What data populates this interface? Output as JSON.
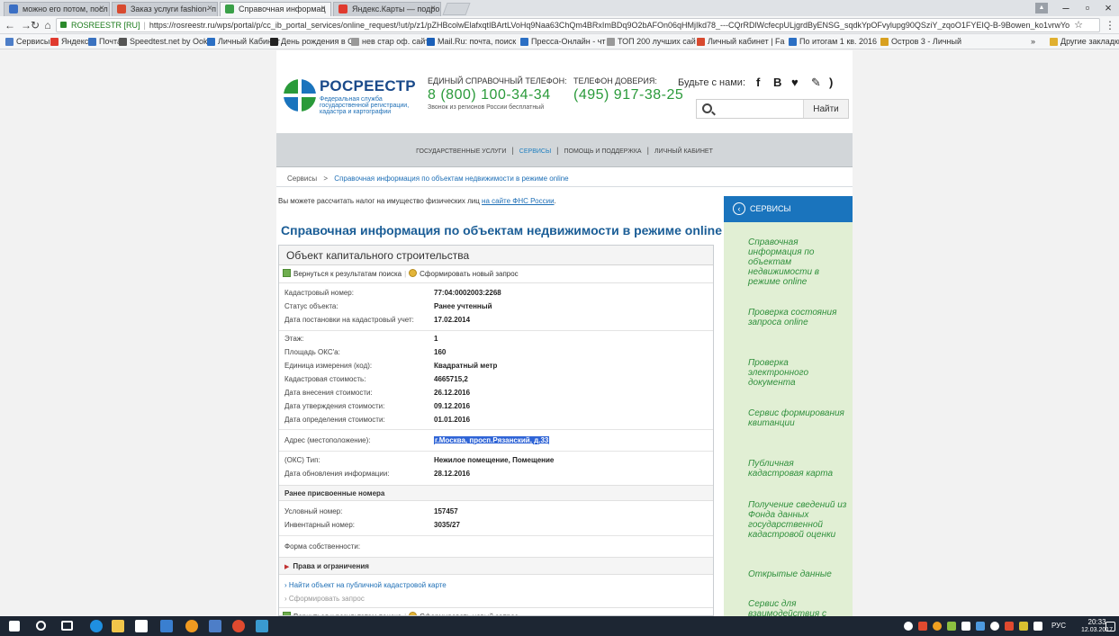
{
  "browser": {
    "tabs": [
      {
        "title": "можно его потом, посл",
        "active": false,
        "favicon_color": "#3b6fc4"
      },
      {
        "title": "Заказ услуги fashion- п",
        "active": false,
        "favicon_color": "#d84a2f"
      },
      {
        "title": "Справочная информац",
        "active": true,
        "favicon_color": "#3aa048"
      },
      {
        "title": "Яндекс.Карты — подро",
        "active": false,
        "favicon_color": "#e03a2f"
      }
    ],
    "address": {
      "site_label": "ROSREESTR [RU]",
      "url": "https://rosreestr.ru/wps/portal/p/cc_ib_portal_services/online_request/!ut/p/z1/pZHBcolwElafxqtIBArtLVoHq9Naa63ChQm4BRxImBDq9O2bAFOn06qHMjIkd78_---CQrRDlWcfecpULjgrdByENSG_sqdkYpOFvylupg90QSziY_zqoO1FYEIQ-B-9Bowen_ko1vrwYo"
    },
    "bookmarks": [
      {
        "label": "Сервисы",
        "color": "#4d7ec8"
      },
      {
        "label": "Яндекс",
        "color": "#e03a2f"
      },
      {
        "label": "Почта",
        "color": "#3a72c0"
      },
      {
        "label": "Speedtest.net by Ook",
        "color": "#555555"
      },
      {
        "label": "Личный Кабинет",
        "color": "#2b6fc4"
      },
      {
        "label": "День рождения в Ст",
        "color": "#222222"
      },
      {
        "label": "нев стар оф. сайт",
        "color": "#999999"
      },
      {
        "label": "Mail.Ru: почта, поиск",
        "color": "#1a5fb8"
      },
      {
        "label": "Пресса-Онлайн - чт",
        "color": "#2b6fc4"
      },
      {
        "label": "ТОП 200 лучших сай",
        "color": "#999999"
      },
      {
        "label": "Личный кабинет | Fa",
        "color": "#d84a2f"
      },
      {
        "label": "По итогам 1 кв. 2016",
        "color": "#2b6fc4"
      },
      {
        "label": "Остров 3 - Личный",
        "color": "#d8a020"
      },
      {
        "label": "»",
        "color": ""
      },
      {
        "label": "Другие закладки",
        "color": "#e0b030"
      }
    ]
  },
  "header": {
    "logo_title": "РОСРЕЕСТР",
    "logo_subtitle": "Федеральная служба государственной регистрации, кадастра и картографии",
    "hotline_label": "ЕДИНЫЙ СПРАВОЧНЫЙ ТЕЛЕФОН:",
    "hotline_phone": "8 (800) 100-34-34",
    "hotline_note": "Звонок из регионов России бесплатный",
    "trust_label": "ТЕЛЕФОН ДОВЕРИЯ:",
    "trust_phone": "(495) 917-38-25",
    "social_label": "Будьте с нами:",
    "social_icons": [
      "facebook-icon",
      "vk-icon",
      "twitter-icon",
      "hand-icon",
      "rss-icon"
    ],
    "search_placeholder": "",
    "search_button": "Найти"
  },
  "topnav": {
    "items": [
      "ГОСУДАРСТВЕННЫЕ УСЛУГИ",
      "СЕРВИСЫ",
      "ПОМОЩЬ И ПОДДЕРЖКА",
      "ЛИЧНЫЙ КАБИНЕТ"
    ],
    "separator": "|"
  },
  "breadcrumbs": {
    "root": "Сервисы",
    "arrow": ">",
    "current": "Справочная информация по объектам недвижимости в режиме online"
  },
  "notice": {
    "text": "Вы можете рассчитать налог на имущество физических лиц ",
    "link": "на сайте ФНС России",
    "end": "."
  },
  "main": {
    "title": "Справочная информация по объектам недвижимости в режиме online",
    "card_title": "Объект капитального строительства",
    "tool_back": "Вернуться к результатам поиска",
    "tool_sep": "|",
    "tool_new": "Сформировать новый запрос",
    "rows_top": [
      {
        "label": "Кадастровый номер:",
        "value": "77:04:0002003:2268"
      },
      {
        "label": "Статус объекта:",
        "value": "Ранее учтенный"
      },
      {
        "label": "Дата постановки на кадастровый учет:",
        "value": "17.02.2014"
      }
    ],
    "rows_mid": [
      {
        "label": "Этаж:",
        "value": "1"
      },
      {
        "label": "Площадь ОКС'а:",
        "value": "160"
      },
      {
        "label": "Единица измерения (код):",
        "value": "Квадратный метр"
      },
      {
        "label": "Кадастровая стоимость:",
        "value": "4665715,2"
      },
      {
        "label": "Дата внесения стоимости:",
        "value": "26.12.2016"
      },
      {
        "label": "Дата утверждения стоимости:",
        "value": "09.12.2016"
      },
      {
        "label": "Дата определения стоимости:",
        "value": "01.01.2016"
      }
    ],
    "address_label": "Адрес (местоположение):",
    "address_value": "г.Москва, просп.Рязанский, д.33",
    "rows_type": [
      {
        "label": "(ОКС) Тип:",
        "value": "Нежилое помещение, Помещение"
      },
      {
        "label": "Дата обновления информации:",
        "value": "28.12.2016"
      }
    ],
    "prev_numbers_title": "Ранее присвоенные номера",
    "rows_prev": [
      {
        "label": "Условный номер:",
        "value": "157457"
      },
      {
        "label": "Инвентарный номер:",
        "value": "3035/27"
      }
    ],
    "ownership_label": "Форма собственности:",
    "rights_title": "Права и ограничения",
    "link_map": "› Найти объект на публичной кадастровой карте",
    "link_request": "› Сформировать запрос"
  },
  "sidebar": {
    "header": "СЕРВИСЫ",
    "items": [
      "Справочная информация по объектам недвижимости в режиме online",
      "Проверка состояния запроса online",
      "Проверка электронного документа",
      "Сервис формирования квитанции",
      "Публичная кадастровая карта",
      "Получение сведений из Фонда данных государственной кадастровой оценки",
      "Открытые данные",
      "Сервис для взаимодействия с"
    ]
  },
  "taskbar": {
    "lang": "РУС",
    "time": "20:33",
    "date": "12.03.2017"
  },
  "colors": {
    "brand_blue": "#1a74bd",
    "title_blue": "#1a5d96",
    "phone_green": "#2a9a3a",
    "sidebar_bg": "#e1efd4",
    "sidebar_text": "#2f8f3c"
  }
}
